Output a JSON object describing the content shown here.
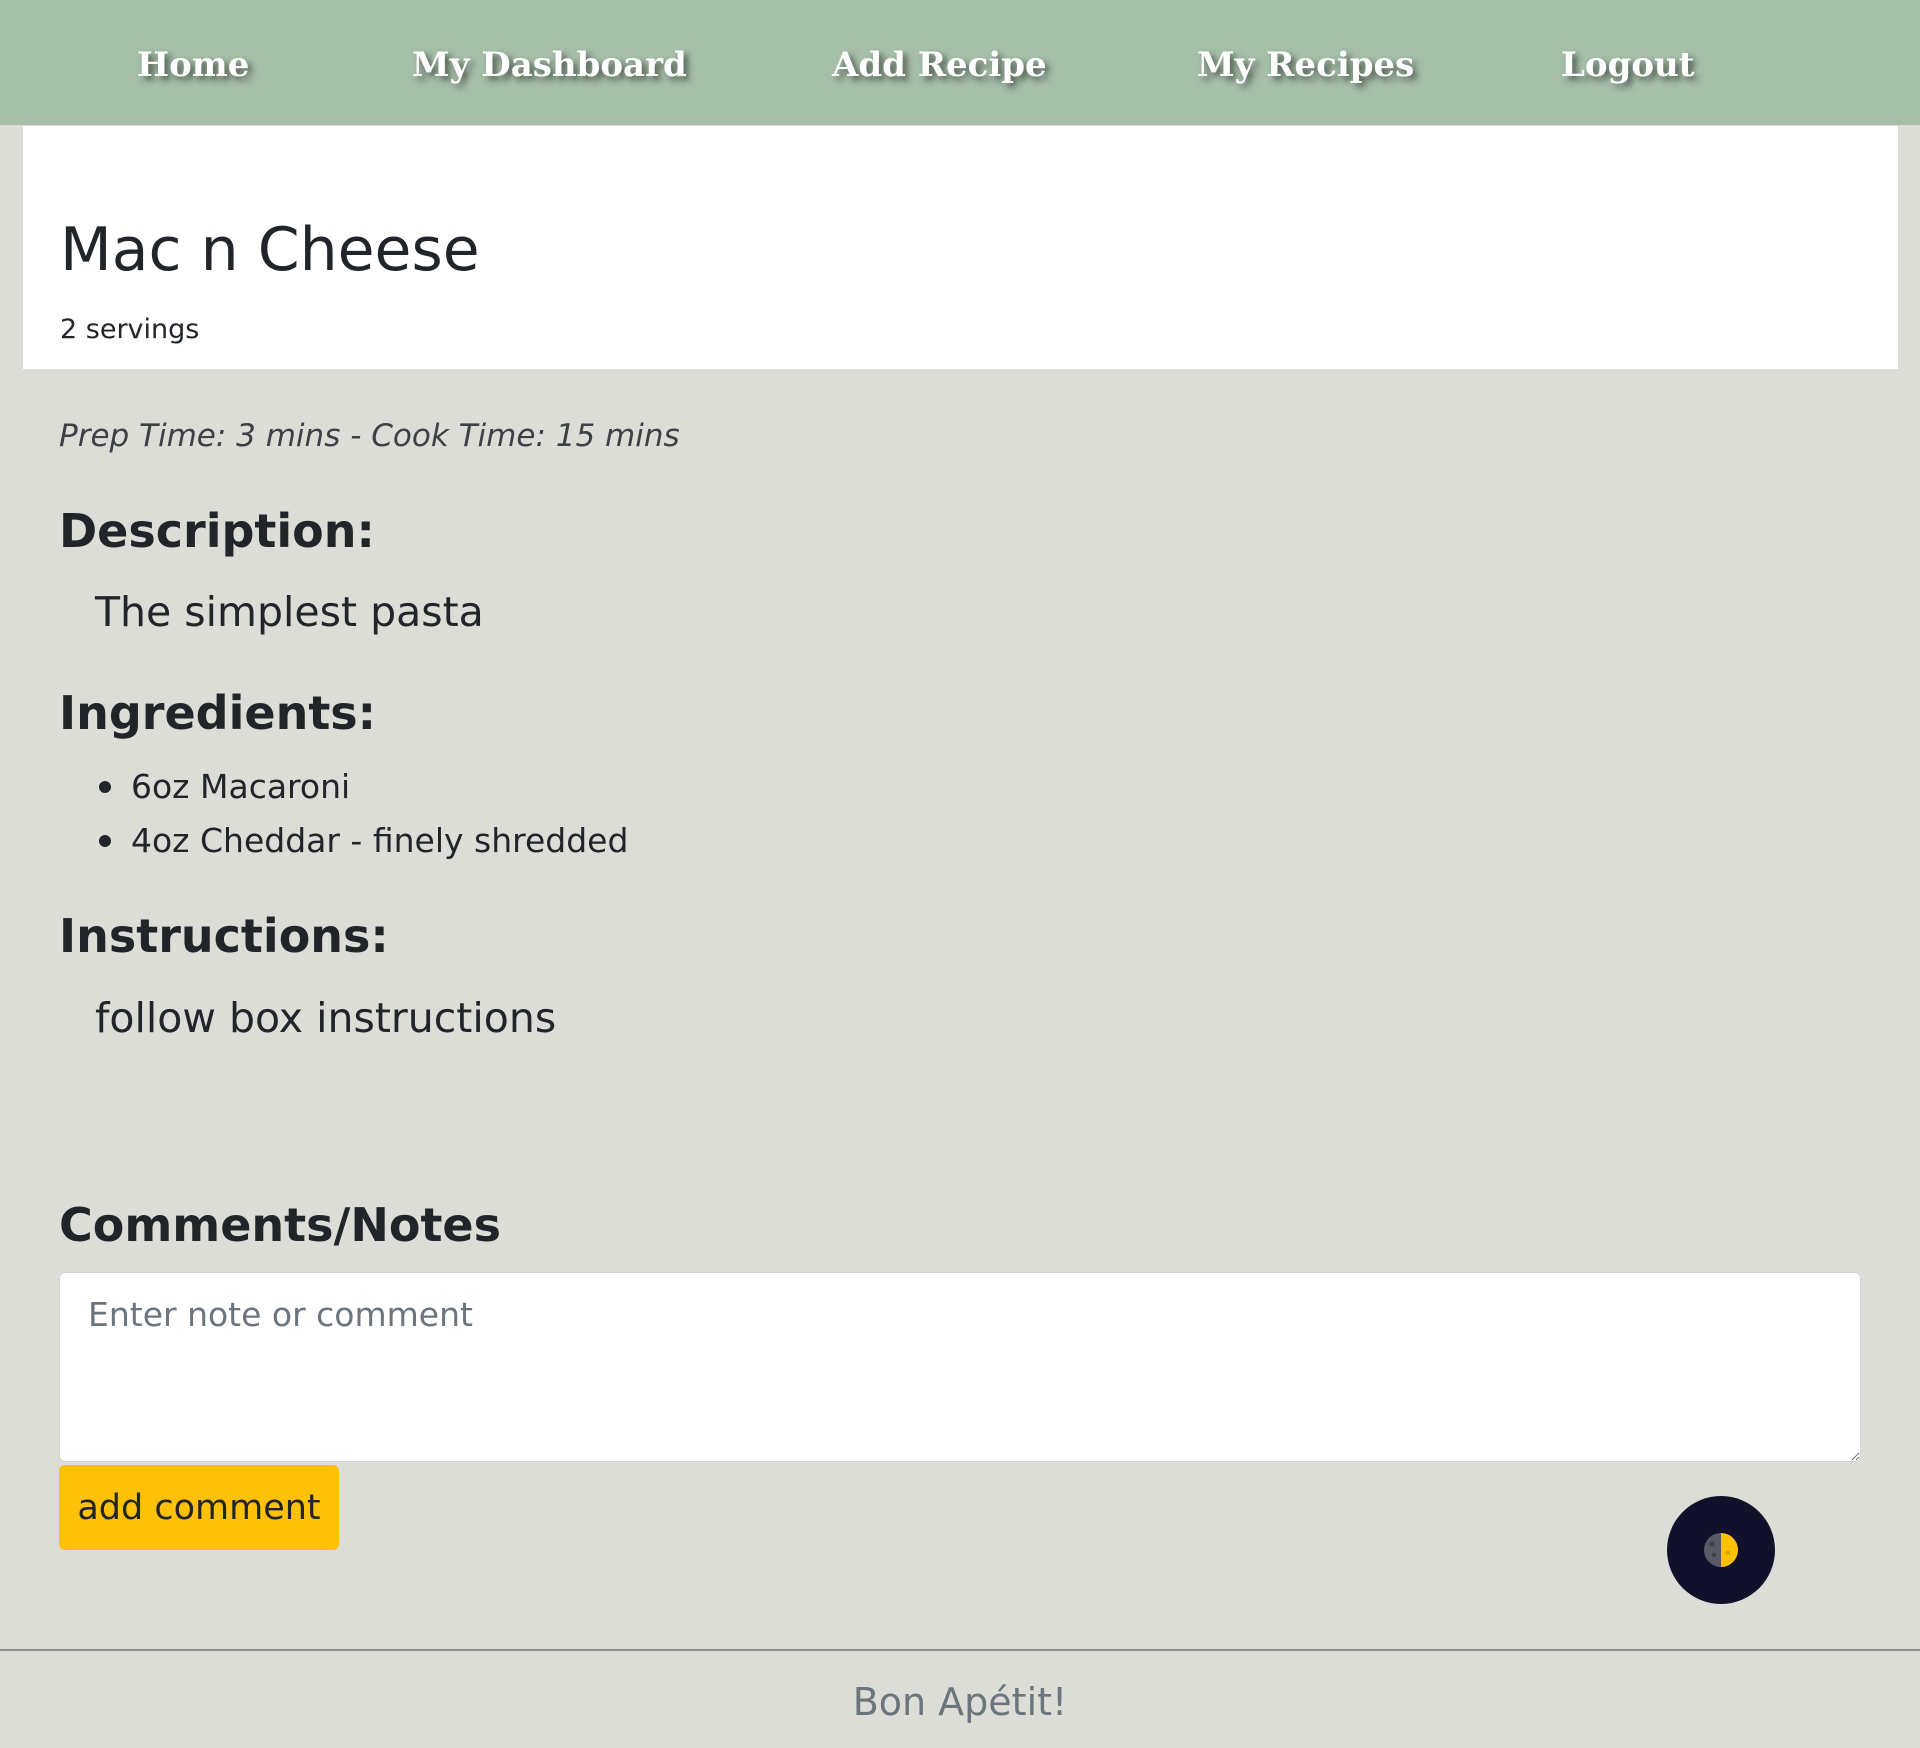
{
  "nav": {
    "items": [
      {
        "label": "Home"
      },
      {
        "label": "My Dashboard"
      },
      {
        "label": "Add Recipe"
      },
      {
        "label": "My Recipes"
      },
      {
        "label": "Logout"
      }
    ]
  },
  "recipe": {
    "title": "Mac n Cheese",
    "servings": "2 servings",
    "times": "Prep Time: 3 mins - Cook Time: 15 mins",
    "description_heading": "Description:",
    "description": "The simplest pasta",
    "ingredients_heading": "Ingredients:",
    "ingredients": [
      "6oz Macaroni",
      "4oz Cheddar - finely shredded"
    ],
    "instructions_heading": "Instructions:",
    "instructions": "follow box instructions"
  },
  "comments": {
    "heading": "Comments/Notes",
    "placeholder": "Enter note or comment",
    "value": "",
    "button_label": "add comment"
  },
  "theme_toggle": {
    "icon": "moon-half-icon",
    "colors": {
      "background": "#11112b",
      "moon_light": "#ffc107",
      "moon_dark": "#5a5a66"
    }
  },
  "footer": {
    "text": "Bon Apétit!"
  },
  "colors": {
    "navbar": "#a6bfa9",
    "page_background": "#dcddd6",
    "card_background": "#ffffff",
    "accent_button": "#ffc107"
  }
}
